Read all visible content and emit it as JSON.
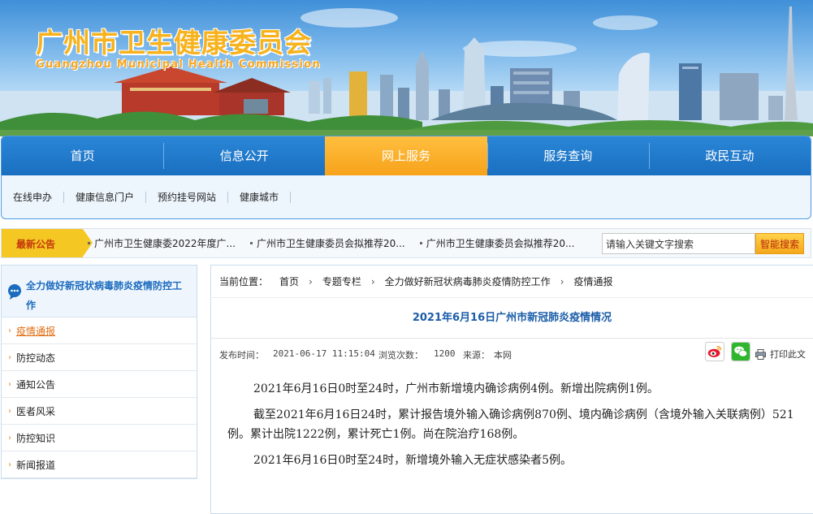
{
  "header": {
    "title_cn": "广州市卫生健康委员会",
    "title_en": "Guangzhou Municipal Health Commission"
  },
  "nav": {
    "items": [
      {
        "label": "首页"
      },
      {
        "label": "信息公开"
      },
      {
        "label": "网上服务"
      },
      {
        "label": "服务查询"
      },
      {
        "label": "政民互动"
      }
    ],
    "active_label": "网上服务",
    "sub_items": [
      {
        "label": "在线申办"
      },
      {
        "label": "健康信息门户"
      },
      {
        "label": "预约挂号网站"
      },
      {
        "label": "健康城市"
      }
    ]
  },
  "notice": {
    "tag": "最新公告",
    "items": [
      {
        "text": "广州市卫生健康委2022年度广..."
      },
      {
        "text": "广州市卫生健康委员会拟推荐20..."
      },
      {
        "text": "广州市卫生健康委员会拟推荐20..."
      }
    ]
  },
  "search": {
    "value": "请输入关键文字搜索",
    "button": "智能搜索"
  },
  "sidebar": {
    "title_line1": "全力做好新冠状病毒肺炎疫情防控工",
    "title_line2": "作",
    "icon": "chat-bubble-icon",
    "items": [
      {
        "label": "疫情通报",
        "active": true
      },
      {
        "label": "防控动态"
      },
      {
        "label": "通知公告"
      },
      {
        "label": "医者风采"
      },
      {
        "label": "防控知识"
      },
      {
        "label": "新闻报道"
      }
    ]
  },
  "breadcrumb": {
    "lead": "当前位置：",
    "items": [
      {
        "label": "首页"
      },
      {
        "label": "专题专栏"
      },
      {
        "label": "全力做好新冠状病毒肺炎疫情防控工作"
      },
      {
        "label": "疫情通报"
      }
    ]
  },
  "article": {
    "title": "2021年6月16日广州市新冠肺炎疫情情况",
    "publish_label": "发布时间：",
    "publish_time": "2021-06-17 11:15:04",
    "views_label": "浏览次数：",
    "views": "1200",
    "source_label": "来源：",
    "source": "本网",
    "print_label": "打印此文",
    "share_icons": [
      "weibo-icon",
      "wechat-icon"
    ],
    "paragraphs": [
      "2021年6月16日0时至24时，广州市新增境内确诊病例4例。新增出院病例1例。",
      "截至2021年6月16日24时，累计报告境外输入确诊病例870例、境内确诊病例（含境外输入关联病例）521例。累计出院1222例，累计死亡1例。尚在院治疗168例。",
      "2021年6月16日0时至24时，新增境外输入无症状感染者5例。"
    ]
  },
  "colors": {
    "nav_blue": "#1a6fc0",
    "nav_active": "#f7a21a",
    "title_blue": "#1b5da8",
    "brand_orange": "#f7b21c"
  }
}
